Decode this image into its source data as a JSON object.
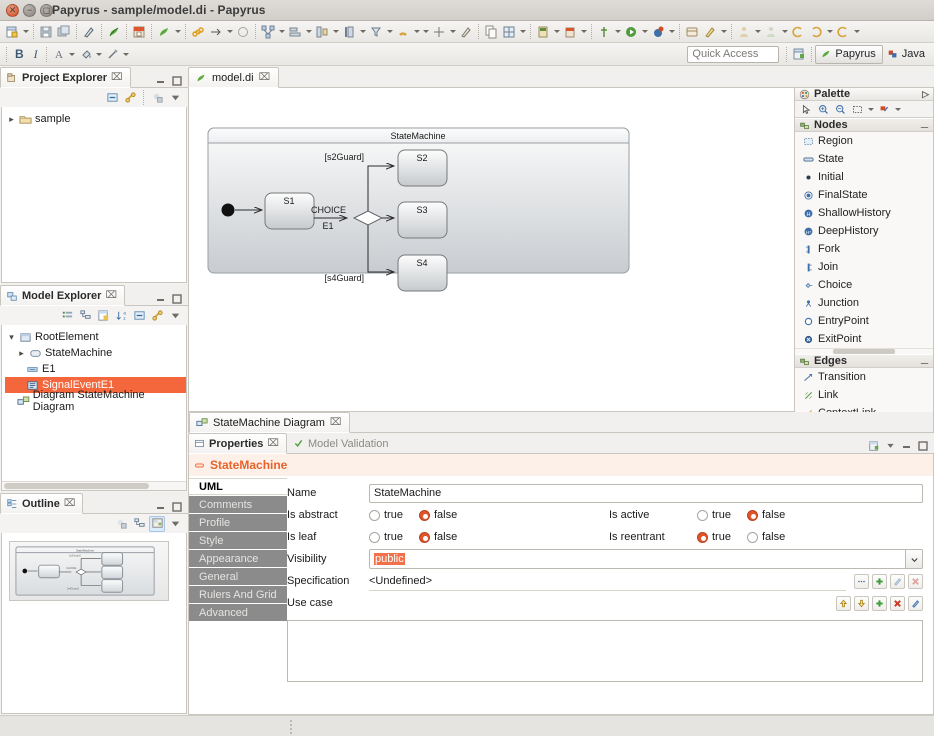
{
  "window": {
    "title": "Papyrus - sample/model.di - Papyrus"
  },
  "toolbar2": {
    "bold": "B",
    "italic": "I"
  },
  "quick_access": {
    "placeholder": "Quick Access"
  },
  "perspectives": [
    {
      "label": "Papyrus",
      "active": true
    },
    {
      "label": "Java",
      "active": false
    }
  ],
  "project_explorer": {
    "title": "Project Explorer",
    "close": "⌧",
    "items": [
      {
        "label": "sample",
        "expandable": true
      }
    ]
  },
  "model_explorer": {
    "title": "Model Explorer",
    "close": "⌧",
    "items": [
      {
        "label": "RootElement",
        "indent": 0,
        "twisty": "down",
        "selected": false
      },
      {
        "label": "StateMachine",
        "indent": 1,
        "twisty": "right",
        "selected": false
      },
      {
        "label": "E1",
        "indent": 1,
        "twisty": "none",
        "selected": false
      },
      {
        "label": "SignalEventE1",
        "indent": 1,
        "twisty": "none",
        "selected": true
      },
      {
        "label": "Diagram StateMachine Diagram",
        "indent": 0,
        "twisty": "none",
        "selected": false
      }
    ]
  },
  "outline": {
    "title": "Outline",
    "close": "⌧"
  },
  "editor": {
    "tab_label": "model.di",
    "close": "⌧"
  },
  "diagram": {
    "frame_title": "StateMachine",
    "states": [
      {
        "name": "S1"
      },
      {
        "name": "S2"
      },
      {
        "name": "S3"
      },
      {
        "name": "S4"
      }
    ],
    "choice_label": "CHOICE",
    "trigger_label": "E1",
    "guards": [
      "[s2Guard]",
      "[s4Guard]"
    ]
  },
  "palette": {
    "title": "Palette",
    "collapse_arrow": "▷",
    "groups": [
      {
        "name": "Nodes",
        "items": [
          "Region",
          "State",
          "Initial",
          "FinalState",
          "ShallowHistory",
          "DeepHistory",
          "Fork",
          "Join",
          "Choice",
          "Junction",
          "EntryPoint",
          "ExitPoint"
        ]
      },
      {
        "name": "Edges",
        "items": [
          "Transition",
          "Link",
          "ContextLink"
        ]
      }
    ]
  },
  "bottom_editor_tab": {
    "label": "StateMachine Diagram",
    "close": "⌧"
  },
  "properties": {
    "tabs": [
      {
        "label": "Properties",
        "active": true,
        "close": "⌧"
      },
      {
        "label": "Model Validation",
        "active": false
      }
    ],
    "heading": "StateMachine",
    "side_tabs": [
      {
        "label": "UML",
        "state": "active"
      },
      {
        "label": "Comments",
        "state": "dim"
      },
      {
        "label": "Profile",
        "state": "dim"
      },
      {
        "label": "Style",
        "state": "dim"
      },
      {
        "label": "Appearance",
        "state": "dim"
      },
      {
        "label": "General",
        "state": "dim"
      },
      {
        "label": "Rulers And Grid",
        "state": "dim"
      },
      {
        "label": "Advanced",
        "state": "dim"
      }
    ],
    "fields": {
      "name_label": "Name",
      "name_value": "StateMachine",
      "is_abstract_label": "Is abstract",
      "is_abstract_value": "false",
      "is_active_label": "Is active",
      "is_active_value": "false",
      "is_leaf_label": "Is leaf",
      "is_leaf_value": "false",
      "is_reentrant_label": "Is reentrant",
      "is_reentrant_value": "true",
      "true_label": "true",
      "false_label": "false",
      "visibility_label": "Visibility",
      "visibility_value": "public",
      "specification_label": "Specification",
      "specification_value": "<Undefined>",
      "use_case_label": "Use case"
    }
  },
  "colors": {
    "accent_orange": "#e8622a",
    "selection_orange": "#f4663c",
    "radio_on": "#e0542a",
    "panel_bg": "#f4f3f1",
    "chrome": "#e9e7e3"
  }
}
